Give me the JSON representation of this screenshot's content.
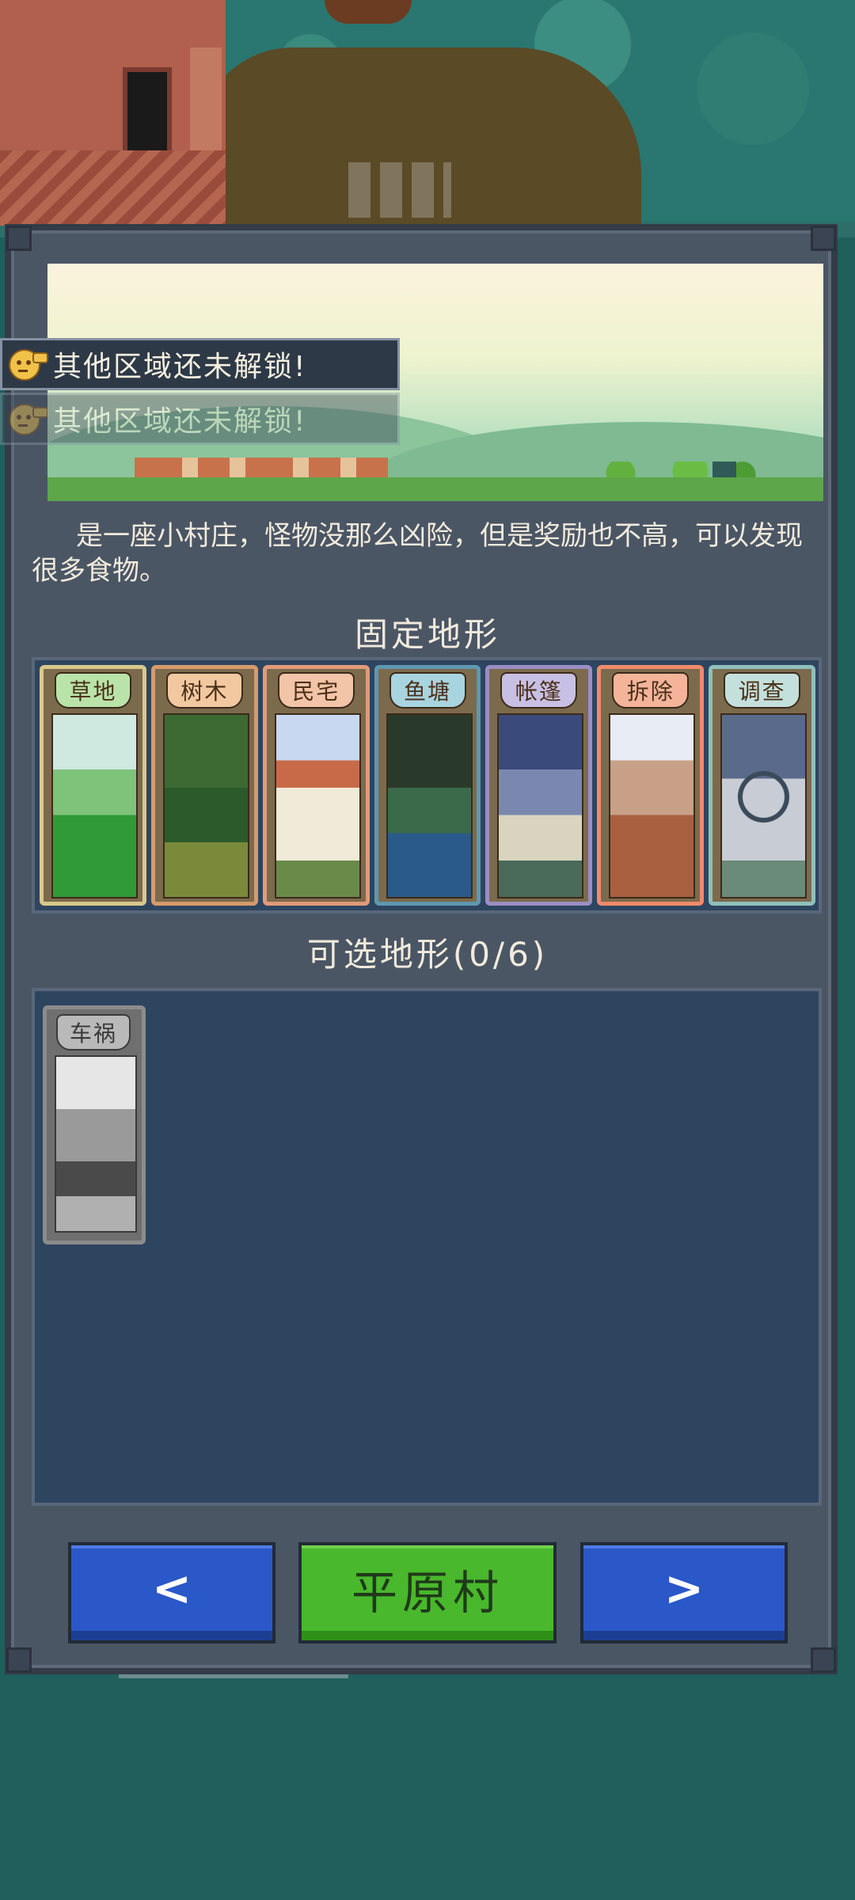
{
  "toasts": [
    {
      "text": "其他区域还未解锁!"
    },
    {
      "text": "其他区域还未解锁!"
    }
  ],
  "area": {
    "description": "是一座小村庄，怪物没那么凶险，但是奖励也不高，可以发现很多食物。",
    "fixed_title": "固定地形",
    "optional_title": "可选地形(0/6)",
    "name": "平原村"
  },
  "fixed_terrains": [
    {
      "label": "草地",
      "color": "#3fa34a"
    },
    {
      "label": "树木",
      "color": "#d39c6a"
    },
    {
      "label": "民宅",
      "color": "#e28a6a"
    },
    {
      "label": "鱼塘",
      "color": "#4c8aa3"
    },
    {
      "label": "帐篷",
      "color": "#8e82b8"
    },
    {
      "label": "拆除",
      "color": "#e8735a"
    },
    {
      "label": "调查",
      "color": "#7fb2b0"
    }
  ],
  "optional_terrains": [
    {
      "label": "车祸",
      "color": "#9a9a9a"
    }
  ],
  "nav": {
    "prev": "<",
    "next": ">"
  }
}
